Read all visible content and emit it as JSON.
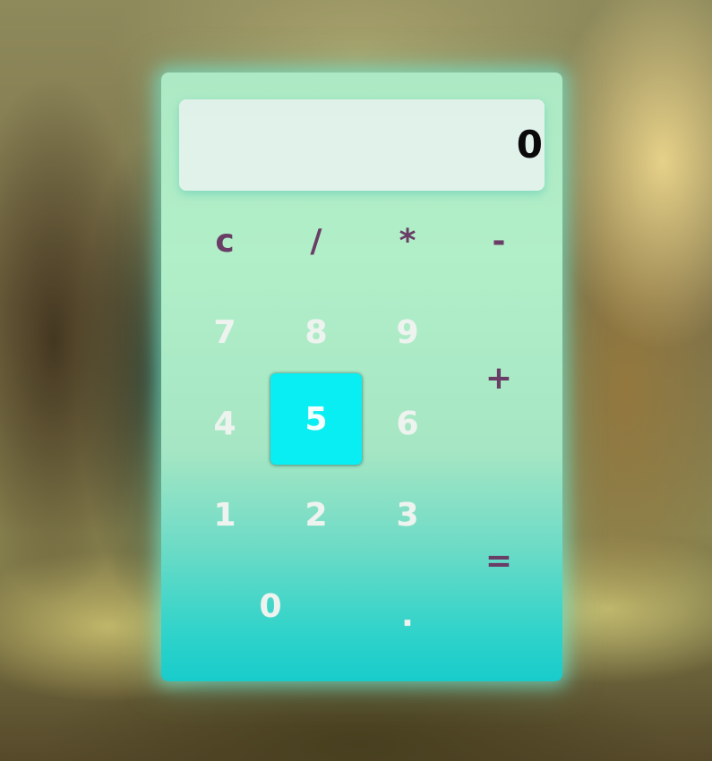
{
  "display": {
    "value": "0"
  },
  "keys": {
    "clear": "c",
    "divide": "/",
    "multiply": "*",
    "subtract": "-",
    "seven": "7",
    "eight": "8",
    "nine": "9",
    "add": "+",
    "four": "4",
    "five": "5",
    "six": "6",
    "one": "1",
    "two": "2",
    "three": "3",
    "equals": "=",
    "zero": "0",
    "decimal": "."
  },
  "state": {
    "highlighted_key": "5"
  },
  "colors": {
    "operator_text": "#6a3d66",
    "number_text": "#eef3ef",
    "active_key_bg": "#09eef2",
    "display_text": "#0a0a0a"
  }
}
